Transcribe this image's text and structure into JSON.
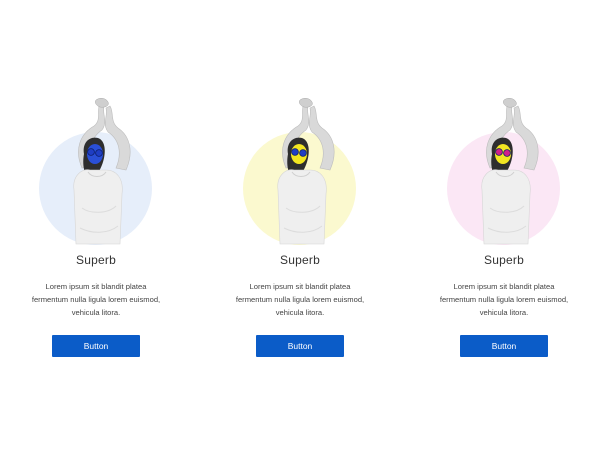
{
  "cards": [
    {
      "title": "Superb",
      "description": "Lorem ipsum sit blandit platea fermentum nulla ligula lorem euismod, vehicula litora.",
      "button_label": "Button",
      "image_icon": "woman-portrait-image",
      "circle_color": "#e6eefa",
      "face_color": "#2a4fd6",
      "lens_color": "#1f3ec4"
    },
    {
      "title": "Superb",
      "description": "Lorem ipsum sit blandit platea fermentum nulla ligula lorem euismod, vehicula litora.",
      "button_label": "Button",
      "image_icon": "woman-portrait-image",
      "circle_color": "#fbf9cf",
      "face_color": "#f2e622",
      "lens_color": "#1f3ec4"
    },
    {
      "title": "Superb",
      "description": "Lorem ipsum sit blandit platea fermentum nulla ligula lorem euismod, vehicula litora.",
      "button_label": "Button",
      "image_icon": "woman-portrait-image",
      "circle_color": "#fbe7f5",
      "face_color": "#f2e622",
      "lens_color": "#d11f8a"
    }
  ],
  "button_color": "#0b5cc8"
}
